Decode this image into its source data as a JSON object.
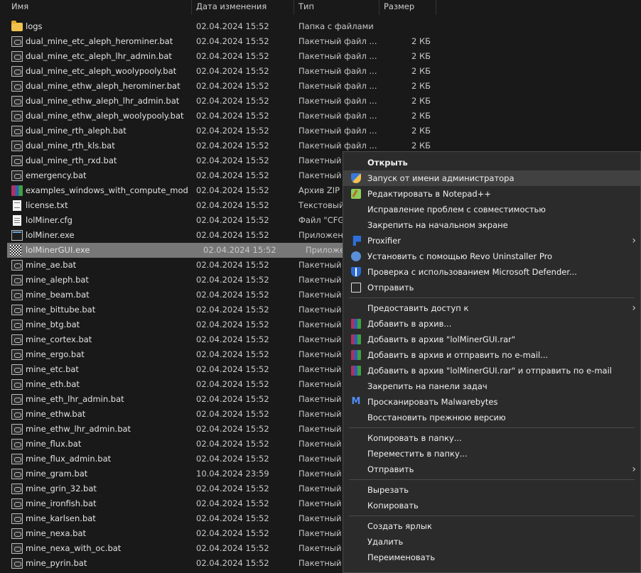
{
  "columns": {
    "name": "Имя",
    "date": "Дата изменения",
    "type": "Тип",
    "size": "Размер"
  },
  "files": [
    {
      "name": "logs",
      "date": "02.04.2024 15:52",
      "type": "Папка с файлами",
      "size": "",
      "icon": "folder-icon"
    },
    {
      "name": "dual_mine_etc_aleph_herominer.bat",
      "date": "02.04.2024 15:52",
      "type": "Пакетный файл ...",
      "size": "2 КБ",
      "icon": "batch-file-icon"
    },
    {
      "name": "dual_mine_etc_aleph_lhr_admin.bat",
      "date": "02.04.2024 15:52",
      "type": "Пакетный файл ...",
      "size": "2 КБ",
      "icon": "batch-file-icon"
    },
    {
      "name": "dual_mine_etc_aleph_woolypooly.bat",
      "date": "02.04.2024 15:52",
      "type": "Пакетный файл ...",
      "size": "2 КБ",
      "icon": "batch-file-icon"
    },
    {
      "name": "dual_mine_ethw_aleph_herominer.bat",
      "date": "02.04.2024 15:52",
      "type": "Пакетный файл ...",
      "size": "2 КБ",
      "icon": "batch-file-icon"
    },
    {
      "name": "dual_mine_ethw_aleph_lhr_admin.bat",
      "date": "02.04.2024 15:52",
      "type": "Пакетный файл ...",
      "size": "2 КБ",
      "icon": "batch-file-icon"
    },
    {
      "name": "dual_mine_ethw_aleph_woolypooly.bat",
      "date": "02.04.2024 15:52",
      "type": "Пакетный файл ...",
      "size": "2 КБ",
      "icon": "batch-file-icon"
    },
    {
      "name": "dual_mine_rth_aleph.bat",
      "date": "02.04.2024 15:52",
      "type": "Пакетный файл ...",
      "size": "2 КБ",
      "icon": "batch-file-icon"
    },
    {
      "name": "dual_mine_rth_kls.bat",
      "date": "02.04.2024 15:52",
      "type": "Пакетный файл ...",
      "size": "2 КБ",
      "icon": "batch-file-icon"
    },
    {
      "name": "dual_mine_rth_rxd.bat",
      "date": "02.04.2024 15:52",
      "type": "Пакетный ф",
      "size": "",
      "icon": "batch-file-icon"
    },
    {
      "name": "emergency.bat",
      "date": "02.04.2024 15:52",
      "type": "Пакетный ф",
      "size": "",
      "icon": "batch-file-icon"
    },
    {
      "name": "examples_windows_with_compute_mod...",
      "date": "02.04.2024 15:52",
      "type": "Архив ZIP -",
      "size": "",
      "icon": "archive-icon"
    },
    {
      "name": "license.txt",
      "date": "02.04.2024 15:52",
      "type": "Текстовый д",
      "size": "",
      "icon": "text-file-icon"
    },
    {
      "name": "lolMiner.cfg",
      "date": "02.04.2024 15:52",
      "type": "Файл \"CFG\"",
      "size": "",
      "icon": "config-file-icon"
    },
    {
      "name": "lolMiner.exe",
      "date": "02.04.2024 15:52",
      "type": "Приложени",
      "size": "",
      "icon": "exe-file-icon"
    },
    {
      "name": "lolMinerGUI.exe",
      "date": "02.04.2024 15:52",
      "type": "Приложени",
      "size": "",
      "icon": "gui-exe-icon",
      "selected": true
    },
    {
      "name": "mine_ae.bat",
      "date": "02.04.2024 15:52",
      "type": "Пакетный ф",
      "size": "",
      "icon": "batch-file-icon"
    },
    {
      "name": "mine_aleph.bat",
      "date": "02.04.2024 15:52",
      "type": "Пакетный ф",
      "size": "",
      "icon": "batch-file-icon"
    },
    {
      "name": "mine_beam.bat",
      "date": "02.04.2024 15:52",
      "type": "Пакетный ф",
      "size": "",
      "icon": "batch-file-icon"
    },
    {
      "name": "mine_bittube.bat",
      "date": "02.04.2024 15:52",
      "type": "Пакетный ф",
      "size": "",
      "icon": "batch-file-icon"
    },
    {
      "name": "mine_btg.bat",
      "date": "02.04.2024 15:52",
      "type": "Пакетный ф",
      "size": "",
      "icon": "batch-file-icon"
    },
    {
      "name": "mine_cortex.bat",
      "date": "02.04.2024 15:52",
      "type": "Пакетный ф",
      "size": "",
      "icon": "batch-file-icon"
    },
    {
      "name": "mine_ergo.bat",
      "date": "02.04.2024 15:52",
      "type": "Пакетный ф",
      "size": "",
      "icon": "batch-file-icon"
    },
    {
      "name": "mine_etc.bat",
      "date": "02.04.2024 15:52",
      "type": "Пакетный ф",
      "size": "",
      "icon": "batch-file-icon"
    },
    {
      "name": "mine_eth.bat",
      "date": "02.04.2024 15:52",
      "type": "Пакетный ф",
      "size": "",
      "icon": "batch-file-icon"
    },
    {
      "name": "mine_eth_lhr_admin.bat",
      "date": "02.04.2024 15:52",
      "type": "Пакетный ф",
      "size": "",
      "icon": "batch-file-icon"
    },
    {
      "name": "mine_ethw.bat",
      "date": "02.04.2024 15:52",
      "type": "Пакетный ф",
      "size": "",
      "icon": "batch-file-icon"
    },
    {
      "name": "mine_ethw_lhr_admin.bat",
      "date": "02.04.2024 15:52",
      "type": "Пакетный ф",
      "size": "",
      "icon": "batch-file-icon"
    },
    {
      "name": "mine_flux.bat",
      "date": "02.04.2024 15:52",
      "type": "Пакетный ф",
      "size": "",
      "icon": "batch-file-icon"
    },
    {
      "name": "mine_flux_admin.bat",
      "date": "02.04.2024 15:52",
      "type": "Пакетный ф",
      "size": "",
      "icon": "batch-file-icon"
    },
    {
      "name": "mine_gram.bat",
      "date": "10.04.2024 23:59",
      "type": "Пакетный ф",
      "size": "",
      "icon": "batch-file-icon"
    },
    {
      "name": "mine_grin_32.bat",
      "date": "02.04.2024 15:52",
      "type": "Пакетный ф",
      "size": "",
      "icon": "batch-file-icon"
    },
    {
      "name": "mine_ironfish.bat",
      "date": "02.04.2024 15:52",
      "type": "Пакетный ф",
      "size": "",
      "icon": "batch-file-icon"
    },
    {
      "name": "mine_karlsen.bat",
      "date": "02.04.2024 15:52",
      "type": "Пакетный ф",
      "size": "",
      "icon": "batch-file-icon"
    },
    {
      "name": "mine_nexa.bat",
      "date": "02.04.2024 15:52",
      "type": "Пакетный ф",
      "size": "",
      "icon": "batch-file-icon"
    },
    {
      "name": "mine_nexa_with_oc.bat",
      "date": "02.04.2024 15:52",
      "type": "Пакетный ф",
      "size": "",
      "icon": "batch-file-icon"
    },
    {
      "name": "mine_pyrin.bat",
      "date": "02.04.2024 15:52",
      "type": "Пакетный ф",
      "size": "",
      "icon": "batch-file-icon"
    }
  ],
  "context_menu": {
    "groups": [
      [
        {
          "label": "Открыть",
          "bold": true,
          "icon": ""
        },
        {
          "label": "Запуск от имени администратора",
          "icon": "uac-shield-icon",
          "hover": true
        },
        {
          "label": "Редактировать в Notepad++",
          "icon": "notepad-plus-plus-icon"
        },
        {
          "label": "Исправление проблем с совместимостью",
          "icon": ""
        },
        {
          "label": "Закрепить на начальном экране",
          "icon": ""
        },
        {
          "label": "Proxifier",
          "icon": "proxifier-icon",
          "submenu": true
        },
        {
          "label": "Установить с помощью Revo Uninstaller Pro",
          "icon": "revo-uninstaller-icon"
        },
        {
          "label": "Проверка с использованием Microsoft Defender...",
          "icon": "defender-icon"
        },
        {
          "label": "Отправить",
          "icon": "share-icon"
        }
      ],
      [
        {
          "label": "Предоставить доступ к",
          "icon": "",
          "submenu": true
        },
        {
          "label": "Добавить в архив...",
          "icon": "winrar-icon"
        },
        {
          "label": "Добавить в архив \"lolMinerGUI.rar\"",
          "icon": "winrar-icon"
        },
        {
          "label": "Добавить в архив и отправить по e-mail...",
          "icon": "winrar-icon"
        },
        {
          "label": "Добавить в архив \"lolMinerGUI.rar\" и отправить по e-mail",
          "icon": "winrar-icon"
        },
        {
          "label": "Закрепить на панели задач",
          "icon": ""
        },
        {
          "label": "Просканировать Malwarebytes",
          "icon": "malwarebytes-icon"
        },
        {
          "label": "Восстановить прежнюю версию",
          "icon": ""
        }
      ],
      [
        {
          "label": "Копировать в папку...",
          "icon": ""
        },
        {
          "label": "Переместить в папку...",
          "icon": ""
        },
        {
          "label": "Отправить",
          "icon": "",
          "submenu": true
        }
      ],
      [
        {
          "label": "Вырезать",
          "icon": ""
        },
        {
          "label": "Копировать",
          "icon": ""
        }
      ],
      [
        {
          "label": "Создать ярлык",
          "icon": ""
        },
        {
          "label": "Удалить",
          "icon": ""
        },
        {
          "label": "Переименовать",
          "icon": ""
        }
      ]
    ],
    "submenu_arrow": "›"
  }
}
